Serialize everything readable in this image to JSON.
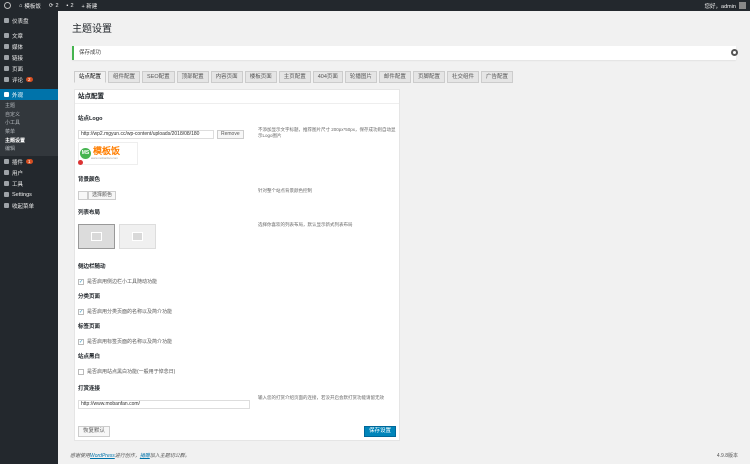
{
  "adminbar": {
    "site_name": "模板饭",
    "updates": "2",
    "comments": "2",
    "new_label": "+ 新建",
    "greeting": "您好，admin"
  },
  "sidebar": {
    "items": [
      {
        "label": "仪表盘"
      },
      {
        "label": "文章"
      },
      {
        "label": "媒体"
      },
      {
        "label": "链接"
      },
      {
        "label": "页面"
      },
      {
        "label": "评论",
        "badge": "2"
      },
      {
        "label": "外观"
      },
      {
        "label": "插件",
        "badge": "1"
      },
      {
        "label": "用户"
      },
      {
        "label": "工具"
      },
      {
        "label": "Settings"
      },
      {
        "label": "收起菜单"
      }
    ],
    "appearance_sub": [
      "主题",
      "自定义",
      "小工具",
      "菜单",
      "主题设置",
      "编辑"
    ]
  },
  "page": {
    "title": "主题设置",
    "notice": "保存成功"
  },
  "tabs": [
    "站点配置",
    "组件配置",
    "SEO配置",
    "顶部配置",
    "内容页面",
    "楼板页面",
    "主页配置",
    "404页面",
    "轮播图片",
    "邮件配置",
    "页脚配置",
    "社交组件",
    "广告配置"
  ],
  "panel": {
    "title": "站点配置",
    "logo": {
      "label": "站点Logo",
      "url": "http://wp2.mgyun.cc/wp-content/uploads/2018/08/180",
      "remove_label": "Remove",
      "desc": "不添加显示文字标题，推荐图片尺寸 200px*50px，保存成功则自动显示Logo图片",
      "logo_ms": "MS",
      "logo_text": "模板饭",
      "logo_sub": "www.mobanfan.com"
    },
    "bgcolor": {
      "label": "背景颜色",
      "button": "选择颜色",
      "desc": "针对整个站点背景颜色控制"
    },
    "list_layout": {
      "label": "列表布局",
      "desc": "选择你喜欢的列表布局，默认显示新式列表布局"
    },
    "sidebar_follow": {
      "label": "侧边栏随动",
      "text": "是否启用侧边栏小工具随动功能"
    },
    "category": {
      "label": "分类页面",
      "text": "是否启用分类页面的名称以及简介功能"
    },
    "tag": {
      "label": "标签页面",
      "text": "是否启用标签页面的名称以及简介功能"
    },
    "blackwhite": {
      "label": "站点黑白",
      "text": "是否启用站点黑白功能(一般用于悼念日)"
    },
    "reward": {
      "label": "打赏连接",
      "value": "http://www.mobanfan.com/",
      "desc": "输入您的打赏介绍页面的连接，若没开启会默打赏功能请留无效"
    },
    "reset_label": "恢复默认",
    "save_label": "保存设置"
  },
  "footer": {
    "thanks_prefix": "感谢使用",
    "wp_link": "WordPress",
    "thanks_mid": "进行创作，",
    "donate_link": "捐赠",
    "thanks_suffix": "加入主题切公群。",
    "version": "4.9.8版本"
  },
  "colors": {
    "adminbar": "#23282d",
    "accent": "#0073aa",
    "success": "#46b450",
    "primary_button": "#0085ba"
  }
}
